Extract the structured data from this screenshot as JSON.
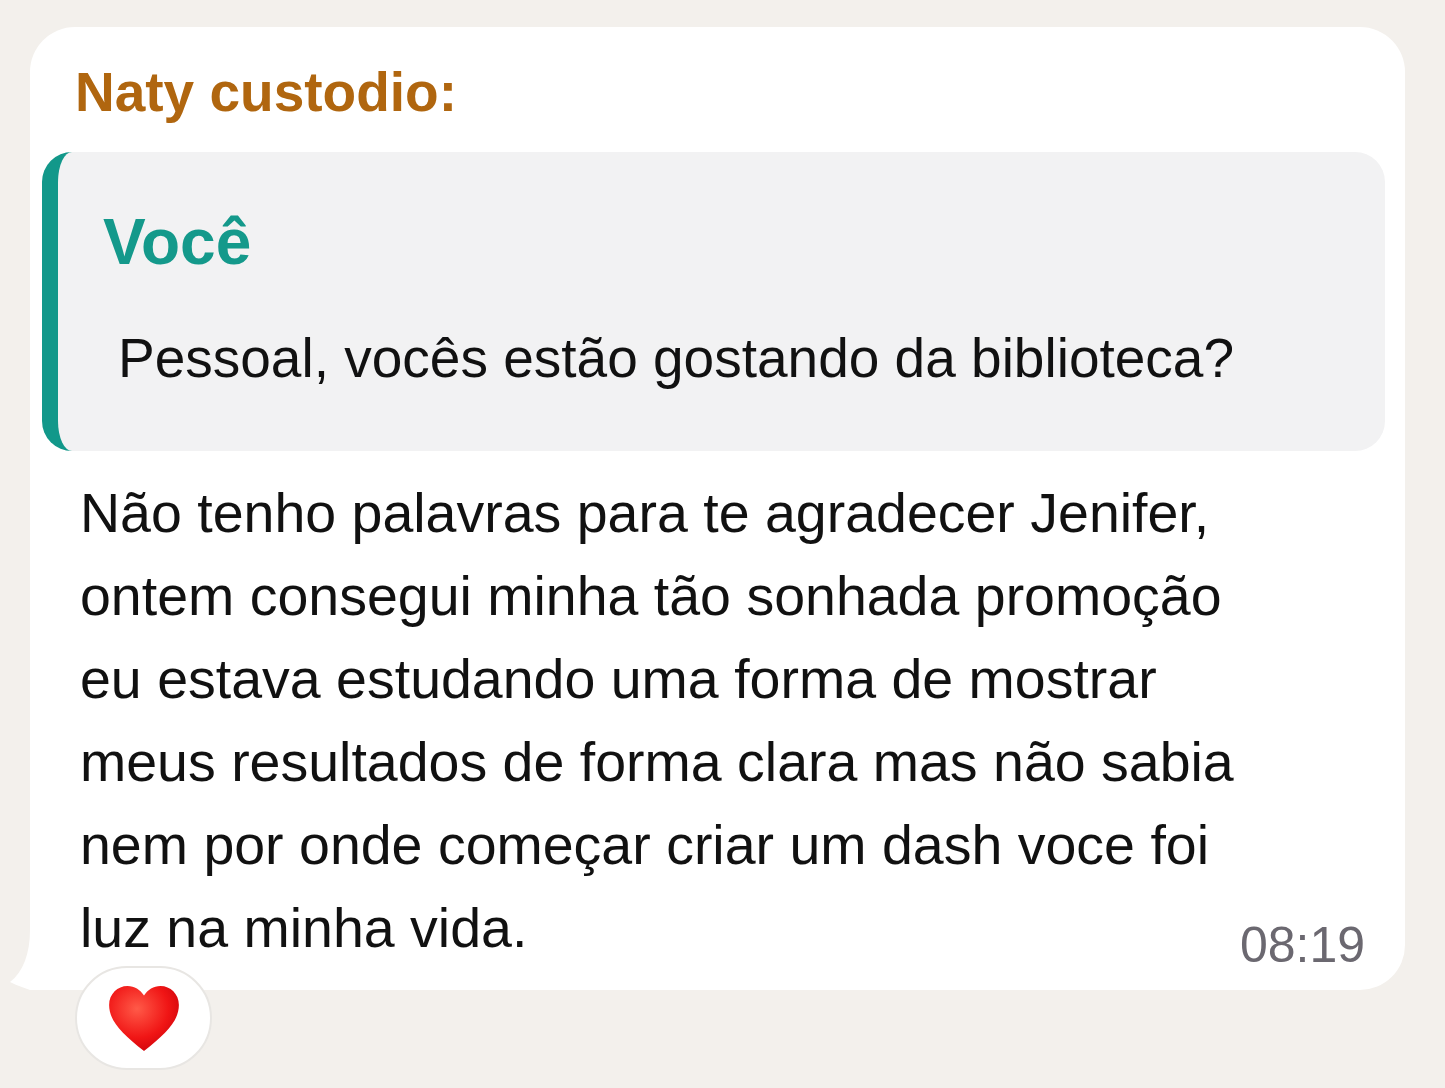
{
  "message": {
    "sender": "Naty custodio:",
    "quote": {
      "author": "Você",
      "text": "Pessoal, vocês estão gostando da biblioteca?"
    },
    "text": "Não tenho palavras para te agradecer Jenifer, ontem consegui minha tão sonhada promoção eu estava estudando uma forma de mostrar meus resultados de forma clara mas não sabia nem por onde começar criar um dash voce foi luz na minha vida.",
    "time": "08:19",
    "reactions": [
      {
        "kind": "heart"
      }
    ]
  }
}
